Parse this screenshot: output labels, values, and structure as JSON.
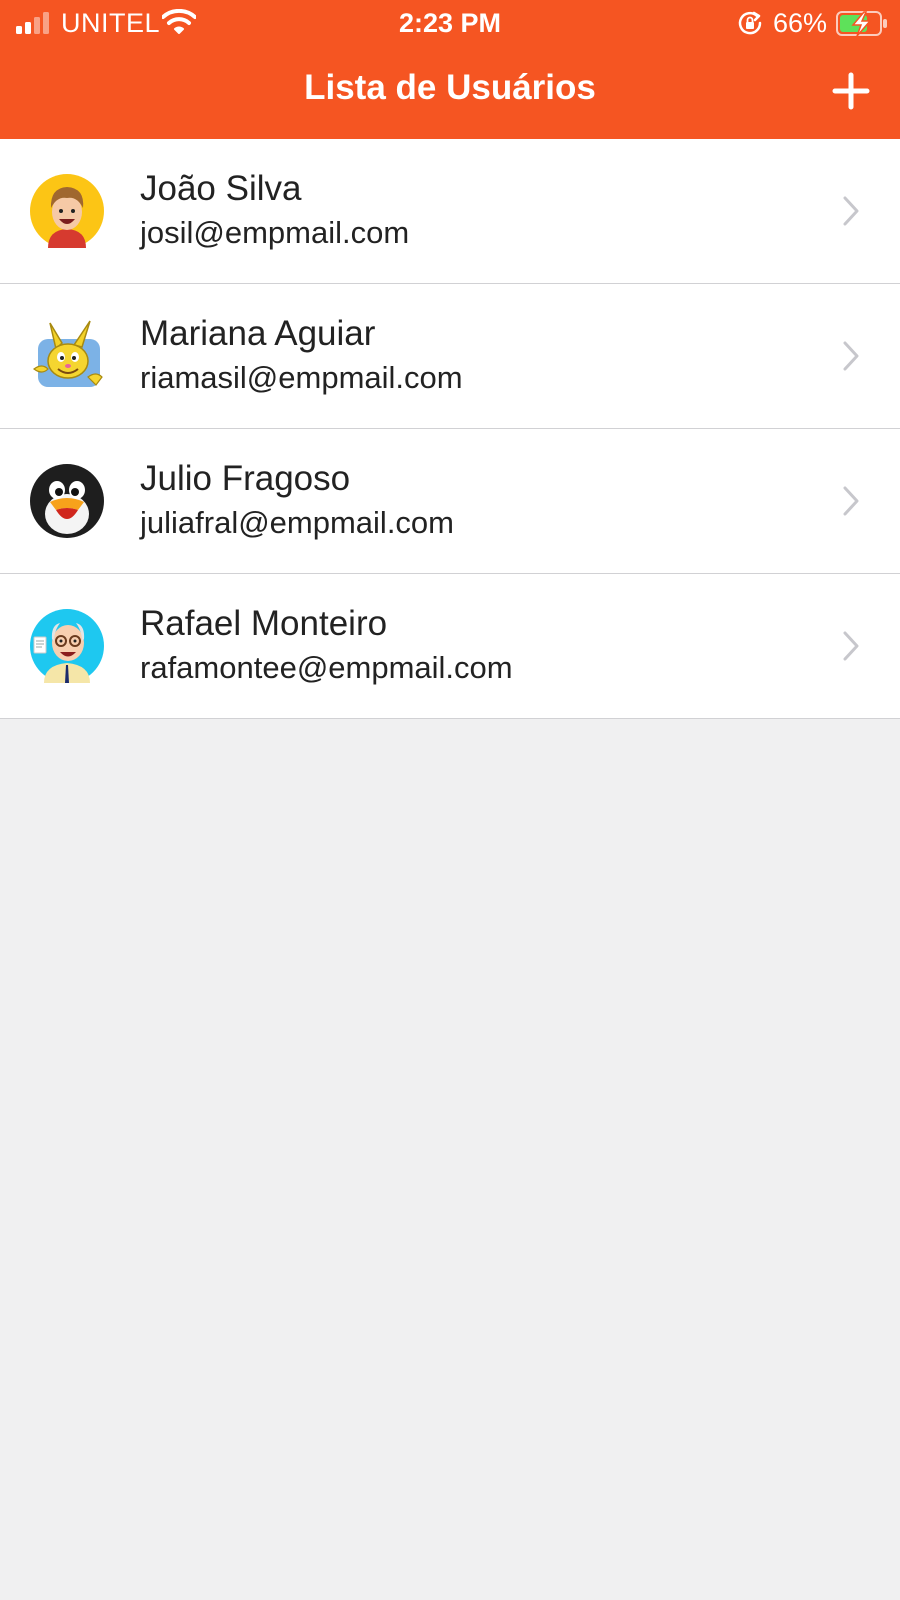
{
  "status_bar": {
    "carrier": "UNITEL",
    "time": "2:23 PM",
    "battery_percent": "66%",
    "icons": [
      "signal-icon",
      "wifi-icon",
      "orientation-lock-icon",
      "battery-charging-icon"
    ]
  },
  "header": {
    "title": "Lista de Usuários",
    "add_icon": "plus-icon",
    "background_color": "#f55522"
  },
  "users": [
    {
      "name": "João Silva",
      "email": "josil@empmail.com",
      "avatar": "cartoon-boy-avatar"
    },
    {
      "name": "Mariana Aguiar",
      "email": "riamasil@empmail.com",
      "avatar": "cartoon-rabbit-avatar"
    },
    {
      "name": "Julio Fragoso",
      "email": "juliafral@empmail.com",
      "avatar": "penguin-avatar"
    },
    {
      "name": "Rafael Monteiro",
      "email": "rafamontee@empmail.com",
      "avatar": "cartoon-teacher-avatar"
    }
  ]
}
